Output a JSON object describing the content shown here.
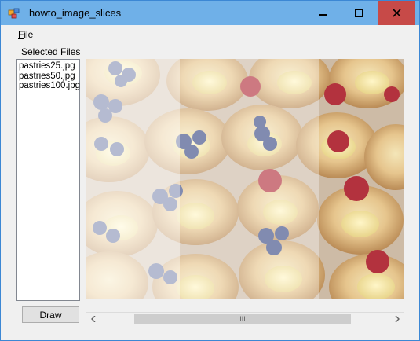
{
  "window": {
    "title": "howto_image_slices",
    "controls": [
      "minimize-icon",
      "maximize-icon",
      "close-icon"
    ]
  },
  "menu": {
    "file_accesskey": "F",
    "file_rest": "ile"
  },
  "selected_files": {
    "label": "Selected Files",
    "items": [
      "pastries25.jpg",
      "pastries50.jpg",
      "pastries100.jpg"
    ]
  },
  "image": {
    "content": "pastries photo, three vertical slices shown at increasing opacity"
  },
  "draw_button": {
    "label": "Draw"
  },
  "scrollbar": {
    "left_icon": "chevron-left-icon",
    "right_icon": "chevron-right-icon",
    "grip": "III"
  },
  "colors": {
    "titlebar": "#6fb0e8",
    "close": "#c74a48",
    "window_bg": "#f0f0f0"
  }
}
